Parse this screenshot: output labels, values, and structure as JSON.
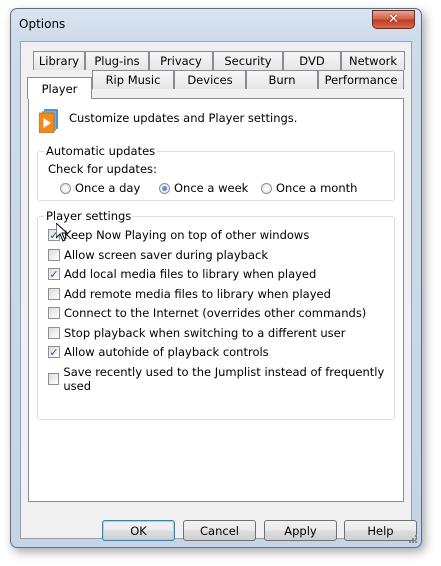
{
  "window": {
    "title": "Options",
    "close_glyph": "✕"
  },
  "tabs": {
    "row_back": [
      "Library",
      "Plug-ins",
      "Privacy",
      "Security",
      "DVD",
      "Network"
    ],
    "row_front": [
      "Player",
      "Rip Music",
      "Devices",
      "Burn",
      "Performance"
    ],
    "active": "Player"
  },
  "header": {
    "icon": "player-icon",
    "description": "Customize updates and Player settings."
  },
  "auto_updates": {
    "legend": "Automatic updates",
    "prompt": "Check for updates:",
    "options": [
      "Once a day",
      "Once a week",
      "Once a month"
    ],
    "selected": "Once a week"
  },
  "player_settings": {
    "legend": "Player settings",
    "items": [
      {
        "label": "Keep Now Playing on top of other windows",
        "checked": true
      },
      {
        "label": "Allow screen saver during playback",
        "checked": false
      },
      {
        "label": "Add local media files to library when played",
        "checked": true
      },
      {
        "label": "Add remote media files to library when played",
        "checked": false
      },
      {
        "label": "Connect to the Internet (overrides other commands)",
        "checked": false
      },
      {
        "label": "Stop playback when switching to a different user",
        "checked": false
      },
      {
        "label": "Allow autohide of playback controls",
        "checked": true
      },
      {
        "label": "Save recently used to the Jumplist instead of frequently used",
        "checked": false
      }
    ]
  },
  "buttons": {
    "ok": "OK",
    "cancel": "Cancel",
    "apply": "Apply",
    "help": "Help"
  },
  "colors": {
    "accent": "#1d5fa8",
    "close": "#c13a22",
    "frame": "#c6d4e6"
  }
}
